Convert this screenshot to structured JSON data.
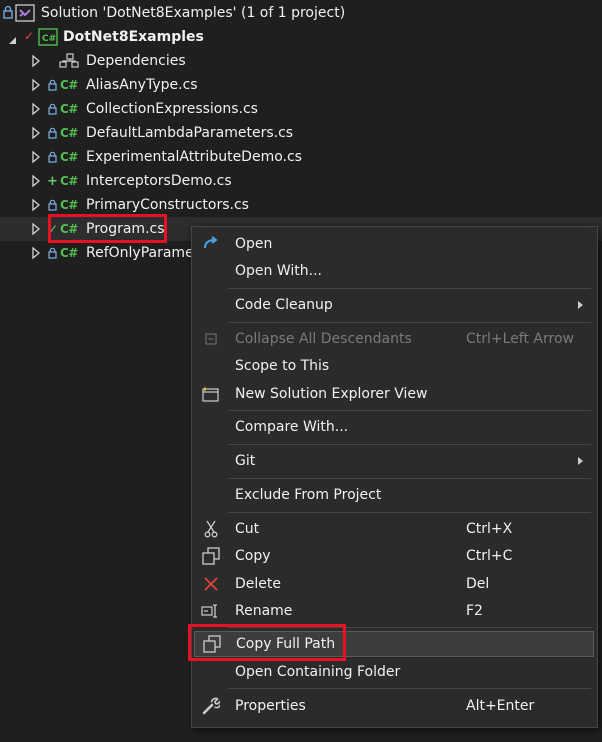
{
  "solution": {
    "label": "Solution 'DotNet8Examples' (1 of 1 project)",
    "project": "DotNet8Examples",
    "dependencies": "Dependencies",
    "files": [
      {
        "name": "AliasAnyType.cs",
        "status": "lock"
      },
      {
        "name": "CollectionExpressions.cs",
        "status": "lock"
      },
      {
        "name": "DefaultLambdaParameters.cs",
        "status": "lock"
      },
      {
        "name": "ExperimentalAttributeDemo.cs",
        "status": "lock"
      },
      {
        "name": "InterceptorsDemo.cs",
        "status": "plus"
      },
      {
        "name": "PrimaryConstructors.cs",
        "status": "lock"
      },
      {
        "name": "Program.cs",
        "status": "check"
      },
      {
        "name": "RefOnlyParamet",
        "status": "lock"
      }
    ],
    "cs_badge": "C#",
    "lock_glyph": "🔒",
    "plus_glyph": "+",
    "check_glyph": "✓"
  },
  "context_menu": {
    "open": "Open",
    "open_with": "Open With...",
    "code_cleanup": "Code Cleanup",
    "collapse_all": "Collapse All Descendants",
    "collapse_all_shortcut": "Ctrl+Left Arrow",
    "scope_to_this": "Scope to This",
    "new_view": "New Solution Explorer View",
    "compare_with": "Compare With...",
    "git": "Git",
    "exclude": "Exclude From Project",
    "cut": "Cut",
    "cut_shortcut": "Ctrl+X",
    "copy": "Copy",
    "copy_shortcut": "Ctrl+C",
    "delete": "Delete",
    "delete_shortcut": "Del",
    "rename": "Rename",
    "rename_shortcut": "F2",
    "copy_full_path": "Copy Full Path",
    "open_folder": "Open Containing Folder",
    "properties": "Properties",
    "properties_shortcut": "Alt+Enter"
  },
  "colors": {
    "background": "#1f1f1f",
    "menu_bg": "#2b2b2b",
    "cs_green": "#4fbf4f",
    "highlight_red": "#e81123",
    "delete_red": "#e0443e",
    "open_blue": "#4aa3e8"
  }
}
